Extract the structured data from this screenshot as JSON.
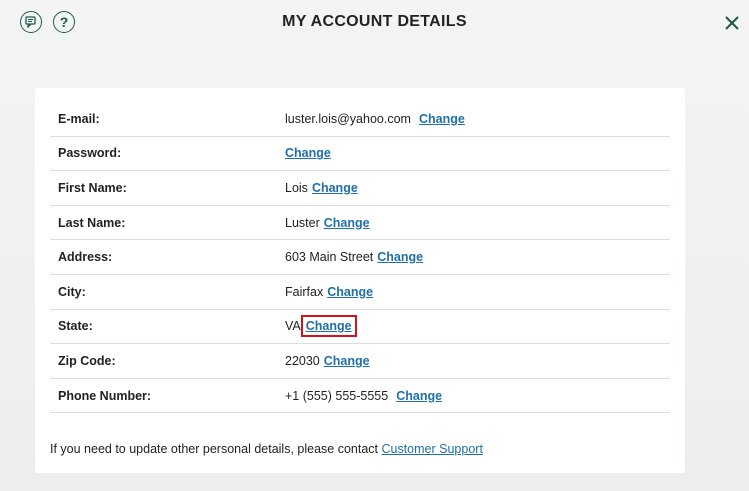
{
  "header": {
    "title": "MY ACCOUNT DETAILS",
    "help_glyph": "?"
  },
  "icons": {
    "chat": "chat-icon",
    "help": "help-icon",
    "close": "close-icon"
  },
  "colors": {
    "accent": "#1d5a4b",
    "link": "#1f6fa8",
    "highlight": "#d0141a"
  },
  "rows": [
    {
      "label": "E-mail:",
      "value": "luster.lois@yahoo.com",
      "action": "Change"
    },
    {
      "label": "Password:",
      "value": "",
      "action": "Change"
    },
    {
      "label": "First Name:",
      "value": "Lois",
      "action": "Change"
    },
    {
      "label": "Last Name:",
      "value": "Luster",
      "action": "Change"
    },
    {
      "label": "Address:",
      "value": "603 Main Street",
      "action": "Change"
    },
    {
      "label": "City:",
      "value": "Fairfax",
      "action": "Change"
    },
    {
      "label": "State:",
      "value": "VA",
      "action": "Change"
    },
    {
      "label": "Zip Code:",
      "value": "22030",
      "action": "Change"
    },
    {
      "label": "Phone Number:",
      "value": "+1 (555) 555-5555",
      "action": "Change"
    }
  ],
  "footer": {
    "text": "If you need to update other personal details, please contact ",
    "link": "Customer Support"
  }
}
